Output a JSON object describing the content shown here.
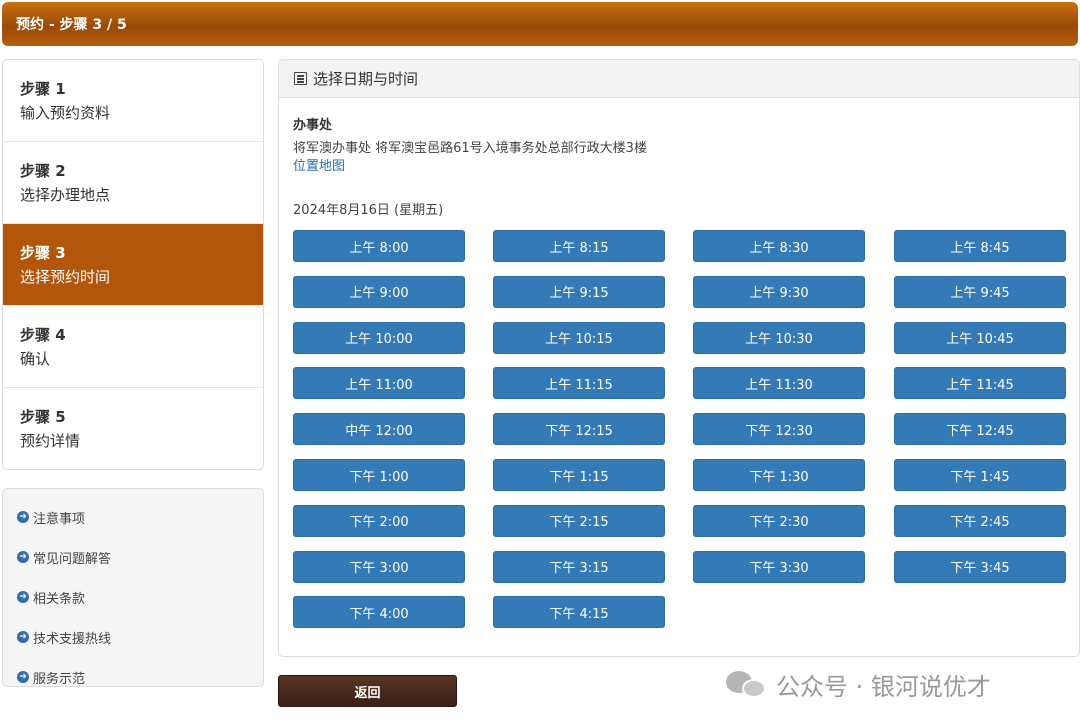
{
  "header": {
    "title": "预约 - 步骤 3 / 5"
  },
  "steps": [
    {
      "num": "步骤 1",
      "desc": "输入预约资料",
      "active": false
    },
    {
      "num": "步骤 2",
      "desc": "选择办理地点",
      "active": false
    },
    {
      "num": "步骤 3",
      "desc": "选择预约时间",
      "active": true
    },
    {
      "num": "步骤 4",
      "desc": "确认",
      "active": false
    },
    {
      "num": "步骤 5",
      "desc": "预约详情",
      "active": false
    }
  ],
  "links": [
    "注意事项",
    "常见问题解答",
    "相关条款",
    "技术支援热线",
    "服务示范"
  ],
  "panel": {
    "title": "选择日期与时间",
    "office_label": "办事处",
    "office_address": "将军澳办事处 将军澳宝邑路61号入境事务处总部行政大楼3楼",
    "map_link": "位置地图",
    "date": "2024年8月16日 (星期五)"
  },
  "slots": [
    "上午 8:00",
    "上午 8:15",
    "上午 8:30",
    "上午 8:45",
    "上午 9:00",
    "上午 9:15",
    "上午 9:30",
    "上午 9:45",
    "上午 10:00",
    "上午 10:15",
    "上午 10:30",
    "上午 10:45",
    "上午 11:00",
    "上午 11:15",
    "上午 11:30",
    "上午 11:45",
    "中午 12:00",
    "下午 12:15",
    "下午 12:30",
    "下午 12:45",
    "下午 1:00",
    "下午 1:15",
    "下午 1:30",
    "下午 1:45",
    "下午 2:00",
    "下午 2:15",
    "下午 2:30",
    "下午 2:45",
    "下午 3:00",
    "下午 3:15",
    "下午 3:30",
    "下午 3:45",
    "下午 4:00",
    "下午 4:15"
  ],
  "back_label": "返回",
  "watermark": "公众号 · 银河说优才",
  "colors": {
    "header": "#a8520a",
    "active_step": "#b2560c",
    "slot_button": "#337ab7",
    "back_button": "#4a2a1b"
  }
}
